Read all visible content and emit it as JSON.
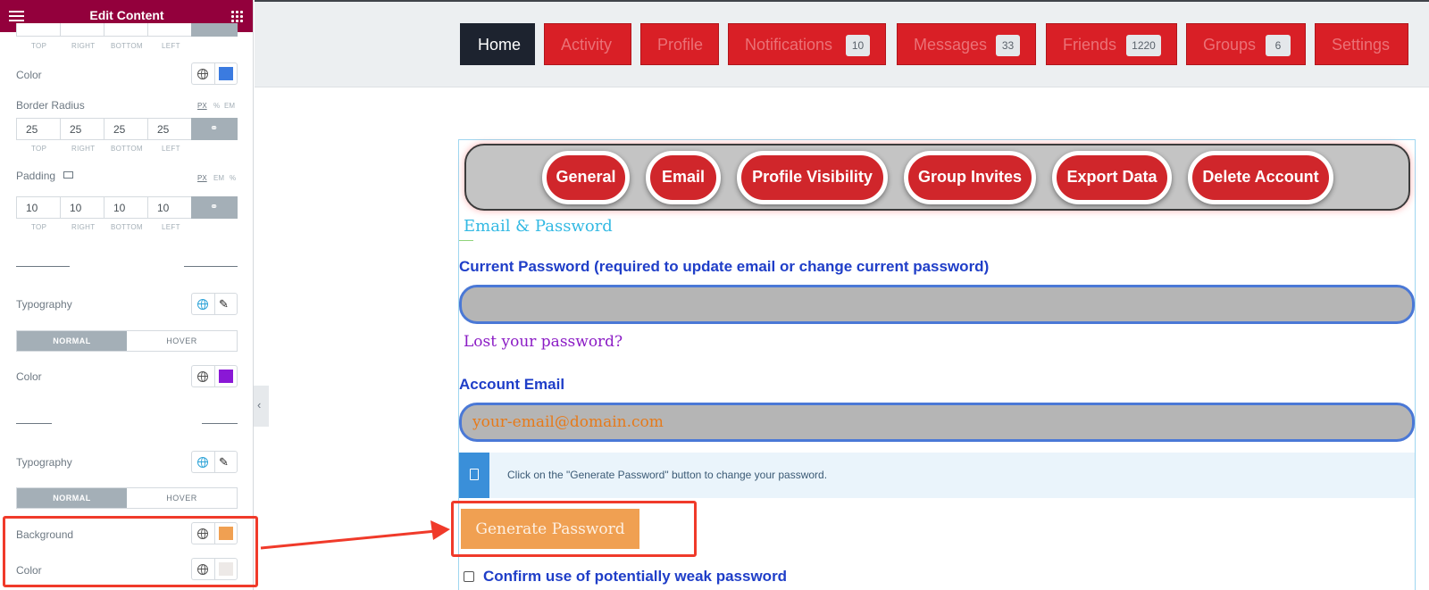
{
  "panel": {
    "title": "Edit Content",
    "dimension_labels": [
      "TOP",
      "RIGHT",
      "BOTTOM",
      "LEFT"
    ],
    "color_label": "Color",
    "color_swatch": "#3b7be0",
    "border_radius": {
      "label": "Border Radius",
      "units": [
        "PX",
        "%",
        "EM"
      ],
      "values": [
        "25",
        "25",
        "25",
        "25"
      ]
    },
    "padding": {
      "label": "Padding",
      "units": [
        "PX",
        "EM",
        "%"
      ],
      "values": [
        "10",
        "10",
        "10",
        "10"
      ]
    },
    "typography_label": "Typography",
    "tabs": {
      "normal": "NORMAL",
      "hover": "HOVER"
    },
    "color2_swatch": "#8a18d6",
    "background_label": "Background",
    "background_swatch": "#f0a052",
    "color3_swatch": "#ede9e7"
  },
  "nav": [
    {
      "label": "Home"
    },
    {
      "label": "Activity"
    },
    {
      "label": "Profile"
    },
    {
      "label": "Notifications",
      "badge": "10"
    },
    {
      "label": "Messages",
      "badge": "33"
    },
    {
      "label": "Friends",
      "badge": "1220"
    },
    {
      "label": "Groups",
      "badge": "6"
    },
    {
      "label": "Settings"
    }
  ],
  "subnav": [
    "General",
    "Email",
    "Profile Visibility",
    "Group Invites",
    "Export Data",
    "Delete Account"
  ],
  "form": {
    "heading": "Email & Password",
    "current_password_label": "Current Password (required to update email or change current password)",
    "current_password_value": "",
    "lost_password_link": "Lost your password?",
    "account_email_label": "Account Email",
    "account_email_placeholder": "your-email@domain.com",
    "notice": "Click on the \"Generate Password\" button to change your password.",
    "generate_button": "Generate Password",
    "weak_password_label": "Confirm use of potentially weak password"
  }
}
